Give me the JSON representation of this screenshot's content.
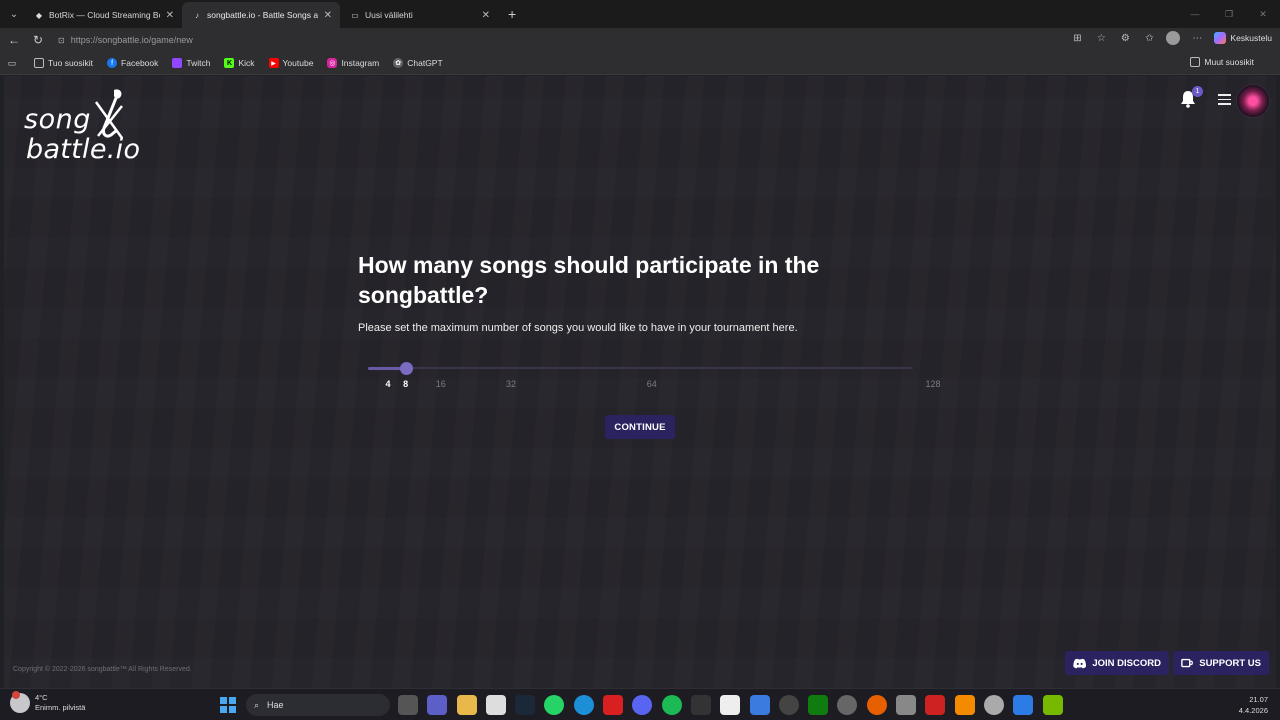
{
  "browser": {
    "tabs": [
      {
        "title": "BotRix — Cloud Streaming Bot for",
        "icon": "botrix-icon",
        "active": false
      },
      {
        "title": "songbattle.io - Battle Songs again",
        "icon": "songbattle-icon",
        "active": true
      },
      {
        "title": "Uusi välilehti",
        "icon": "page-icon",
        "active": false
      }
    ],
    "url": "https://songbattle.io/game/new",
    "copilot_label": "Keskustelu",
    "bookmarks": [
      {
        "label": "Tuo suosikit",
        "icon": "import-icon",
        "color": "#555555"
      },
      {
        "label": "Facebook",
        "icon": "facebook-icon",
        "color": "#1877f2"
      },
      {
        "label": "Twitch",
        "icon": "twitch-icon",
        "color": "#9146ff"
      },
      {
        "label": "Kick",
        "icon": "kick-icon",
        "color": "#53fc18"
      },
      {
        "label": "Youtube",
        "icon": "youtube-icon",
        "color": "#ff0000"
      },
      {
        "label": "Instagram",
        "icon": "instagram-icon",
        "color": "#d6249f"
      },
      {
        "label": "ChatGPT",
        "icon": "chatgpt-icon",
        "color": "#666666"
      }
    ],
    "other_bookmarks": "Muut suosikit"
  },
  "page": {
    "brand_line1": "song",
    "brand_line2": "battle.io",
    "notification_count": "1",
    "question": "How many songs should participate in the songbattle?",
    "description": "Please set the maximum number of songs you would like to have in your tournament here.",
    "slider": {
      "min": 4,
      "max": 128,
      "value": 8,
      "ticks": [
        "4",
        "8",
        "16",
        "32",
        "64",
        "128"
      ],
      "tick_values": [
        4,
        8,
        16,
        32,
        64,
        128
      ]
    },
    "continue_label": "CONTINUE",
    "copyright": "Copyright © 2022-2026 songbattle™ All Rights Reserved.",
    "discord_label": "JOIN DISCORD",
    "support_label": "SUPPORT US",
    "accent_color": "#2b2360"
  },
  "taskbar": {
    "temperature": "4°C",
    "weather": "Enimm. pilvistä",
    "search_placeholder": "Hae",
    "time": "21.07",
    "date": "4.4.2026"
  }
}
